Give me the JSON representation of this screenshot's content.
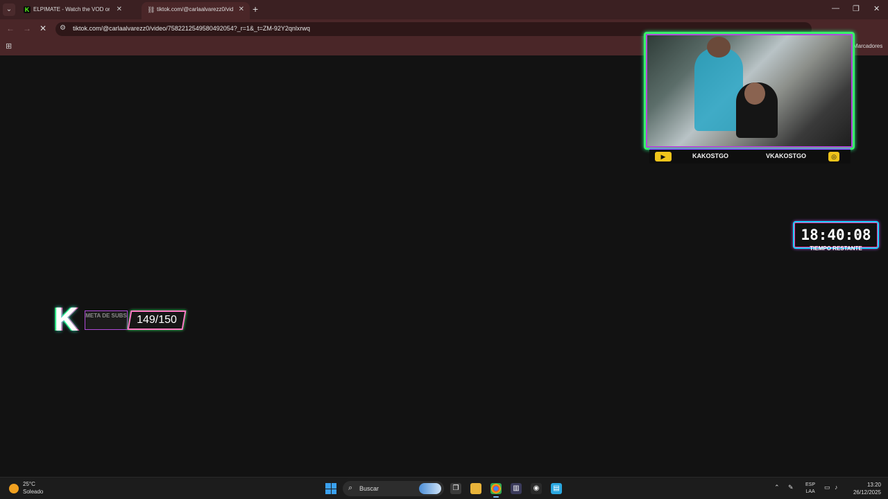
{
  "browser": {
    "tabs": [
      {
        "title": "ELPIMATE - Watch the VOD on",
        "favicon": "K"
      },
      {
        "title": "tiktok.com/@carlaalvarezz0/vid",
        "favicon": "link-icon"
      }
    ],
    "new_tab": "+",
    "url": "tiktok.com/@carlaalvarezz0/video/7582212549580492054?_r=1&_t=ZM-92Y2qnlxrwq",
    "bookmarks_right": "Marcadores"
  },
  "overlay": {
    "handles": {
      "youtube": "KAKOSTGO",
      "instagram": "VKAKOSTGO"
    },
    "timer": {
      "value": "18:40:08",
      "label": "TIEMPO RESTANTE"
    },
    "subs": {
      "logo": "K",
      "label": "META DE SUBS",
      "count": "149/150"
    }
  },
  "taskbar": {
    "weather": {
      "temp": "25°C",
      "condition": "Soleado"
    },
    "search_placeholder": "Buscar",
    "language": {
      "top": "ESP",
      "bottom": "LAA"
    },
    "time": "13:20",
    "date": "26/12/2025"
  },
  "colors": {
    "tabbar": "#3b2022",
    "toolbar": "#4a2628",
    "accent_green": "#39f06a",
    "accent_pink": "#ff3aa8"
  }
}
